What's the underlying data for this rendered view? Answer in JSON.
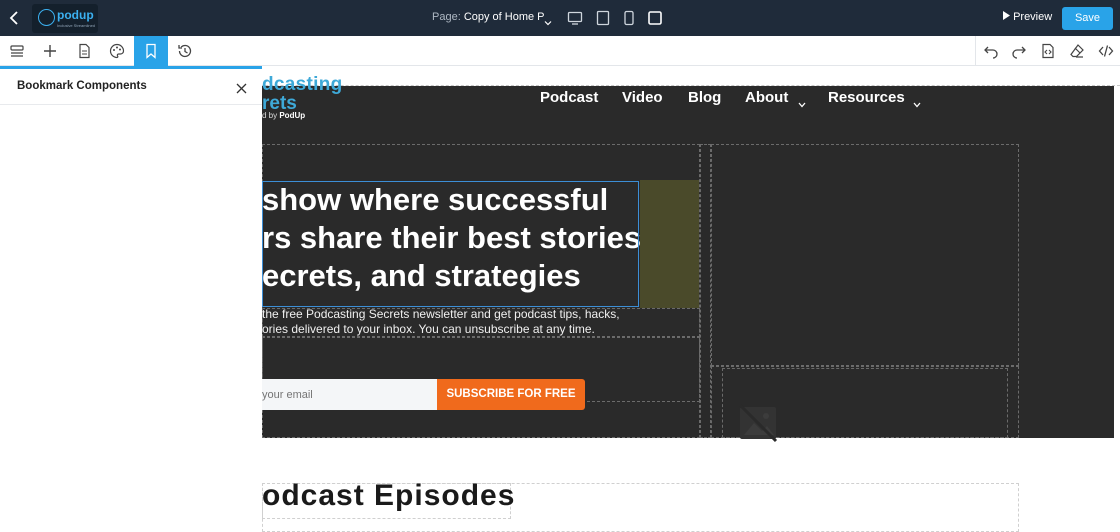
{
  "topbar": {
    "logo_text": "podup",
    "logo_sub": "Inclusive Streamlined",
    "page_label": "Page:",
    "page_name": "Copy of Home P",
    "preview_label": "Preview",
    "save_label": "Save"
  },
  "panel": {
    "title": "Bookmark Components"
  },
  "site": {
    "brand_line1": "dcasting",
    "brand_line2": "rets",
    "brand_by": "d by ",
    "brand_by_name": "PodUp",
    "nav": [
      "Podcast",
      "Video",
      "Blog",
      "About",
      "Resources"
    ],
    "headline": [
      "show where successful",
      "rs share their best stories,",
      "ecrets, and strategies"
    ],
    "subtext": [
      "the free Podcasting Secrets newsletter and get podcast tips, hacks,",
      "ories delivered to your inbox. You can unsubscribe at any time."
    ],
    "email_placeholder": "your email",
    "subscribe_label": "SUBSCRIBE FOR FREE",
    "episodes_heading": "odcast Episodes"
  },
  "colors": {
    "topbar_bg": "#1f2b3a",
    "accent": "#29a3e8",
    "hero_bg": "#2a2a2a",
    "cta": "#f06a1c"
  }
}
